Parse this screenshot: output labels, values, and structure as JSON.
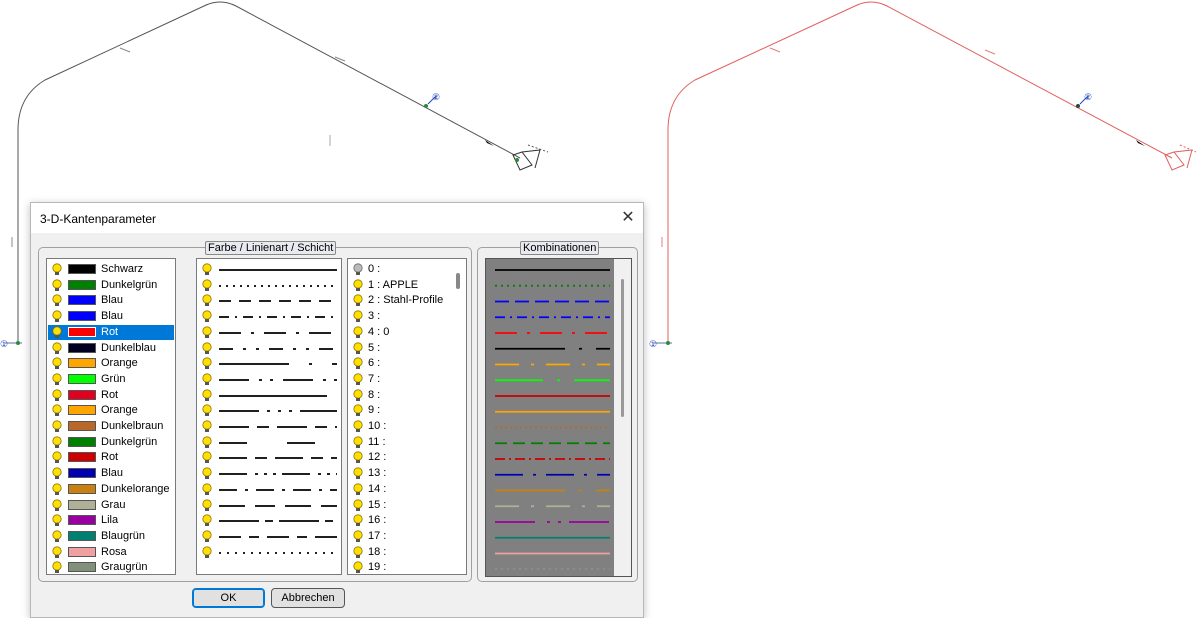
{
  "dialog": {
    "title": "3-D-Kantenparameter",
    "close_icon": "close-x",
    "group_left_label": "Farbe / Linienart / Schicht",
    "group_right_label": "Kombinationen",
    "ok_label": "OK",
    "cancel_label": "Abbrechen"
  },
  "drawing": {
    "markers": [
      "①",
      "②",
      "①",
      "②"
    ]
  },
  "colors": [
    {
      "name": "Schwarz",
      "hex": "#000000"
    },
    {
      "name": "Dunkelgrün",
      "hex": "#008000"
    },
    {
      "name": "Blau",
      "hex": "#0000ff"
    },
    {
      "name": "Blau",
      "hex": "#0000ff"
    },
    {
      "name": "Rot",
      "hex": "#ff0000",
      "selected": true
    },
    {
      "name": "Dunkelblau",
      "hex": "#000020"
    },
    {
      "name": "Orange",
      "hex": "#ffa500"
    },
    {
      "name": "Grün",
      "hex": "#00ff00"
    },
    {
      "name": "Rot",
      "hex": "#e00020"
    },
    {
      "name": "Orange",
      "hex": "#ffa500"
    },
    {
      "name": "Dunkelbraun",
      "hex": "#b86828"
    },
    {
      "name": "Dunkelgrün",
      "hex": "#008000"
    },
    {
      "name": "Rot",
      "hex": "#cc0000"
    },
    {
      "name": "Blau",
      "hex": "#0000b0"
    },
    {
      "name": "Dunkelorange",
      "hex": "#c88010"
    },
    {
      "name": "Grau",
      "hex": "#b0b098"
    },
    {
      "name": "Lila",
      "hex": "#9900a0"
    },
    {
      "name": "Blaugrün",
      "hex": "#008070"
    },
    {
      "name": "Rosa",
      "hex": "#f0a0a0"
    },
    {
      "name": "Graugrün",
      "hex": "#80907a"
    }
  ],
  "linetypes": [
    {
      "dash": "none"
    },
    {
      "dash": "2 5"
    },
    {
      "dash": "12 8"
    },
    {
      "dash": "10 6 2 6"
    },
    {
      "dash": "22 10 3 10"
    },
    {
      "dash": "14 10 3 10 3 10"
    },
    {
      "dash": "70 20 3 20"
    },
    {
      "dash": "30 10 3 8 3 10"
    },
    {
      "dash": "none",
      "short": true
    },
    {
      "dash": "40 8 3 8 3 8 3 8"
    },
    {
      "dash": "30 8 12 8"
    },
    {
      "dash": "28 40"
    },
    {
      "dash": "28 8 12 8"
    },
    {
      "dash": "28 8 3 6 3 6 3 6"
    },
    {
      "dash": "18 8 3 8"
    },
    {
      "dash": "26 10 20 10"
    },
    {
      "dash": "40 6 8 6"
    },
    {
      "dash": "22 8 10 8"
    },
    {
      "dash": "2 6"
    }
  ],
  "layers": [
    "0 :",
    "1 : APPLE",
    "2 : Stahl-Profile",
    "3 :",
    "4 : 0",
    "5 :",
    "6 :",
    "7 :",
    "8 :",
    "9 :",
    "10 :",
    "11 :",
    "12 :",
    "13 :",
    "14 :",
    "15 :",
    "16 :",
    "17 :",
    "18 :",
    "19 :"
  ],
  "combinations": [
    {
      "hex": "#000000",
      "dash": "none"
    },
    {
      "hex": "#008000",
      "dash": "2 4"
    },
    {
      "hex": "#0000ff",
      "dash": "14 6"
    },
    {
      "hex": "#0000ff",
      "dash": "10 5 2 5"
    },
    {
      "hex": "#ff0000",
      "dash": "22 10 3 10"
    },
    {
      "hex": "#000000",
      "dash": "70 14 3 14"
    },
    {
      "hex": "#ffa500",
      "dash": "24 12 3 12"
    },
    {
      "hex": "#00ff00",
      "dash": "48 14 3 14"
    },
    {
      "hex": "#cc0000",
      "dash": "none"
    },
    {
      "hex": "#ffa500",
      "dash": "none"
    },
    {
      "hex": "#b86828",
      "dash": "2 3"
    },
    {
      "hex": "#008000",
      "dash": "12 6"
    },
    {
      "hex": "#cc0000",
      "dash": "10 4 2 4"
    },
    {
      "hex": "#0000b0",
      "dash": "28 10 3 10"
    },
    {
      "hex": "#c88010",
      "dash": "70 14 3 14"
    },
    {
      "hex": "#b0b098",
      "dash": "24 12 3 12"
    },
    {
      "hex": "#9900a0",
      "dash": "40 12 3 8 3 8"
    },
    {
      "hex": "#008070",
      "dash": "none"
    },
    {
      "hex": "#f0a0a0",
      "dash": "none"
    }
  ]
}
